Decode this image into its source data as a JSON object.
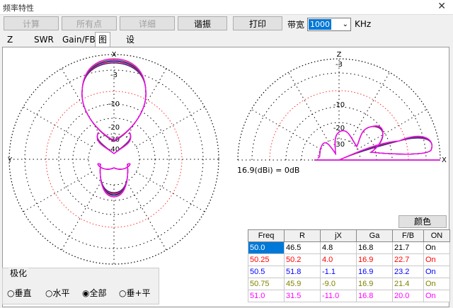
{
  "window": {
    "title": "频率特性",
    "close_glyph": "✕"
  },
  "toolbar": {
    "calc": "计算",
    "all_points": "所有点",
    "detail": "详细",
    "resonance": "谐振",
    "print": "打印",
    "bandwidth_label": "带宽",
    "bandwidth_value": "1000",
    "bandwidth_unit": "KHz"
  },
  "tabs": [
    "Z",
    "SWR",
    "Gain/FB",
    "图形",
    "设置"
  ],
  "chart_data": [
    {
      "type": "polar",
      "view": "horizontal",
      "rings_db": [
        "-3",
        "-10",
        "-20",
        "-30",
        "-40"
      ],
      "axis_labels": {
        "top": "X",
        "left": "Y"
      },
      "series_colors": [
        "#1f1f9f",
        "#ff2020",
        "#0000ff",
        "#808000",
        "#ff00ff"
      ]
    },
    {
      "type": "polar",
      "view": "vertical",
      "rings_db": [
        "-3",
        "-10",
        "-20",
        "-30"
      ],
      "axis_labels": {
        "top": "Z",
        "right": "X"
      },
      "reference": "16.9(dBi) = 0dB"
    }
  ],
  "color_button": "颜色",
  "table": {
    "headers": [
      "Freq",
      "R",
      "jX",
      "Ga",
      "F/B",
      "ON"
    ],
    "rows": [
      {
        "cells": [
          "50.0",
          "46.5",
          "4.8",
          "16.8",
          "21.7",
          "On"
        ],
        "color": "#000000"
      },
      {
        "cells": [
          "50.25",
          "50.2",
          "4.0",
          "16.9",
          "22.7",
          "On"
        ],
        "color": "#ff0000"
      },
      {
        "cells": [
          "50.5",
          "51.8",
          "-1.1",
          "16.9",
          "23.2",
          "On"
        ],
        "color": "#0000ff"
      },
      {
        "cells": [
          "50.75",
          "45.9",
          "-9.0",
          "16.9",
          "21.4",
          "On"
        ],
        "color": "#808000"
      },
      {
        "cells": [
          "51.0",
          "31.5",
          "-11.0",
          "16.8",
          "20.0",
          "On"
        ],
        "color": "#ff00ff"
      }
    ]
  },
  "polarization": {
    "label": "极化",
    "options": [
      "垂直",
      "水平",
      "全部",
      "垂+平"
    ],
    "selected": "全部"
  }
}
